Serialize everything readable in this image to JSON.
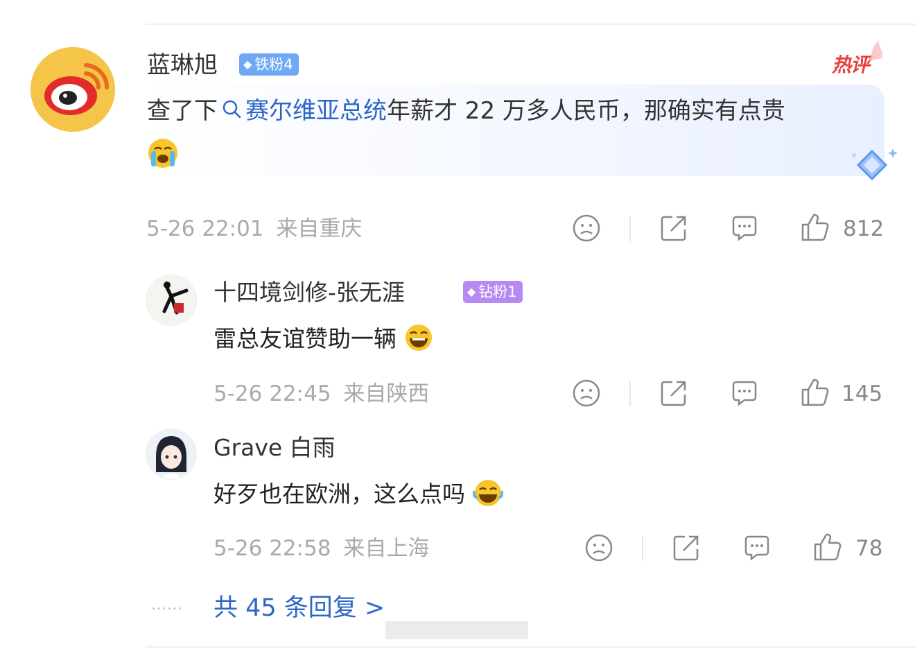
{
  "main_comment": {
    "username": "蓝琳旭",
    "badge": "铁粉4",
    "hot_label": "热评",
    "text_prefix": "查了下",
    "topic": "赛尔维亚总统",
    "text_suffix": "年薪才 22 万多人民币，那确实有点贵",
    "emoji": "crying-laughing",
    "time": "5-26 22:01",
    "location": "来自重庆",
    "likes": "812"
  },
  "replies": [
    {
      "username": "十四境剑修-张无涯",
      "badge": "钻粉1",
      "text": "雷总友谊赞助一辆",
      "emoji": "laughing",
      "time": "5-26 22:45",
      "location": "来自陕西",
      "likes": "145"
    },
    {
      "username": "Grave 白雨",
      "text": "好歹也在欧洲，这么点吗",
      "emoji": "rolling-laughing",
      "time": "5-26 22:58",
      "location": "来自上海",
      "likes": "78"
    }
  ],
  "more": {
    "dots": "……",
    "label": "共 45 条回复 >"
  },
  "colors": {
    "link": "#2d66c9",
    "hot": "#e8413b",
    "iron_badge": "#6fa8f4",
    "diamond_badge": "#b68af2",
    "muted": "#aaaaaa"
  }
}
